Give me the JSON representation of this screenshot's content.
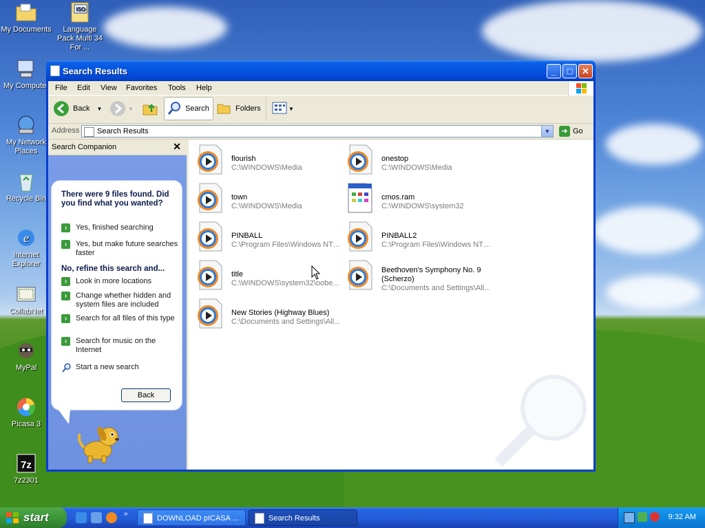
{
  "desktop": {
    "icons": [
      {
        "label": "My Documents"
      },
      {
        "label": "Language Pack Multi 34 For ...",
        "badge": "ISO"
      },
      {
        "label": "My Computer"
      },
      {
        "label": "My Network Places"
      },
      {
        "label": "Recycle Bin"
      },
      {
        "label": "Internet Explorer"
      },
      {
        "label": "CollabNet"
      },
      {
        "label": "MyPal"
      },
      {
        "label": "Picasa 3"
      },
      {
        "label": "7z2301",
        "badge": "7z"
      }
    ]
  },
  "window": {
    "title": "Search Results",
    "controls": {
      "minimize": "_",
      "maximize": "□",
      "close": "✕"
    },
    "menu": [
      "File",
      "Edit",
      "View",
      "Favorites",
      "Tools",
      "Help"
    ],
    "toolbar": {
      "back": "Back",
      "search": "Search",
      "folders": "Folders"
    },
    "address": {
      "label": "Address",
      "value": "Search Results",
      "go": "Go"
    }
  },
  "companion": {
    "header": "Search Companion",
    "close": "✕",
    "summary": "There were 9 files found. Did you find what you wanted?",
    "options_a": [
      "Yes, finished searching",
      "Yes, but make future searches faster"
    ],
    "refine_heading": "No, refine this search and...",
    "options_b": [
      "Look in more locations",
      "Change whether hidden and system files are included",
      "Search for all files of this type",
      "Search for music on the Internet"
    ],
    "new_search": "Start a new search",
    "back_button": "Back"
  },
  "results": [
    {
      "name": "flourish",
      "path": "C:\\WINDOWS\\Media",
      "icon": "media-file-icon"
    },
    {
      "name": "onestop",
      "path": "C:\\WINDOWS\\Media",
      "icon": "media-file-icon"
    },
    {
      "name": "town",
      "path": "C:\\WINDOWS\\Media",
      "icon": "media-file-icon"
    },
    {
      "name": "cmos.ram",
      "path": "C:\\WINDOWS\\system32",
      "icon": "generic-file-icon"
    },
    {
      "name": "PINBALL",
      "path": "C:\\Program Files\\Windows NT\\...",
      "icon": "media-file-icon"
    },
    {
      "name": "PINBALL2",
      "path": "C:\\Program Files\\Windows NT\\...",
      "icon": "media-file-icon"
    },
    {
      "name": "title",
      "path": "C:\\WINDOWS\\system32\\oobe...",
      "icon": "media-file-icon"
    },
    {
      "name": "Beethoven's Symphony No. 9 (Scherzo)",
      "path": "C:\\Documents and Settings\\All...",
      "icon": "media-file-icon"
    },
    {
      "name": "New Stories (Highway Blues)",
      "path": "C:\\Documents and Settings\\All...",
      "icon": "media-file-icon"
    }
  ],
  "taskbar": {
    "start": "start",
    "tasks": [
      "DOWNLOAD pICASA ...",
      "Search Results"
    ],
    "clock": "9:32 AM"
  },
  "colors": {
    "accent": "#0454e0",
    "pane": "#7a9ce8",
    "start": "#3c9639"
  }
}
